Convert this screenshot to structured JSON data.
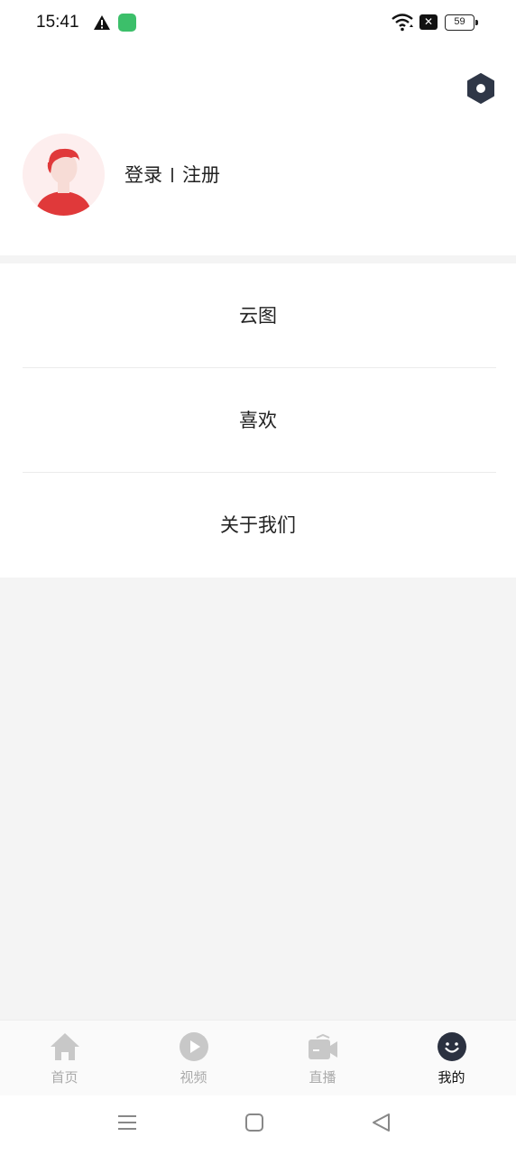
{
  "status_bar": {
    "time": "15:41",
    "battery": "59",
    "icons": [
      "warning-icon",
      "app-notification-icon",
      "wifi-icon",
      "sim-disabled-icon",
      "battery-icon"
    ]
  },
  "profile": {
    "login_label": "登录",
    "register_label": "注册",
    "settings_icon": "settings-hex-icon",
    "avatar_icon": "default-avatar"
  },
  "menu": {
    "items": [
      {
        "label": "云图"
      },
      {
        "label": "喜欢"
      },
      {
        "label": "关于我们"
      }
    ]
  },
  "bottom_nav": {
    "items": [
      {
        "label": "首页",
        "icon": "home-icon",
        "active": false
      },
      {
        "label": "视频",
        "icon": "play-icon",
        "active": false
      },
      {
        "label": "直播",
        "icon": "camera-icon",
        "active": false
      },
      {
        "label": "我的",
        "icon": "smiley-icon",
        "active": true
      }
    ]
  },
  "colors": {
    "accent_red": "#e0393a",
    "inactive_gray": "#c8c8c8",
    "active_dark": "#2b3140",
    "page_bg": "#f4f4f4"
  }
}
